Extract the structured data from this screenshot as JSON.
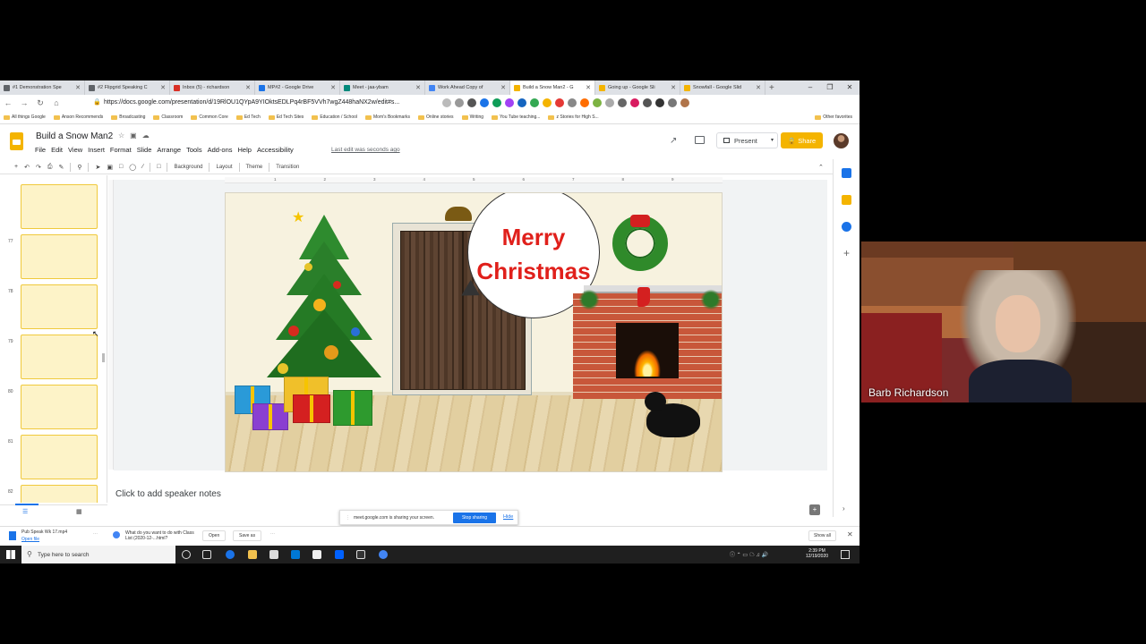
{
  "browser": {
    "tabs": [
      {
        "label": "#1 Demonstration Spe",
        "color": "#5f6368"
      },
      {
        "label": "#2 Flipgrid Speaking C",
        "color": "#5f6368"
      },
      {
        "label": "Inbox (5) - richardson",
        "color": "#d93025"
      },
      {
        "label": "MP#2 - Google Drive",
        "color": "#1a73e8"
      },
      {
        "label": "Meet - jaa-ybam",
        "color": "#00897b"
      },
      {
        "label": "Work Ahead Copy of",
        "color": "#4285f4"
      },
      {
        "label": "Build a Snow Man2 - G",
        "color": "#f4b400"
      },
      {
        "label": "Going up - Google Sli",
        "color": "#f4b400"
      },
      {
        "label": "Snowfall - Google Slid",
        "color": "#f4b400"
      }
    ],
    "active_tab": 6,
    "url": "https://docs.google.com/presentation/d/19RlOU1QYpA9YIOktsEDLPq4rBF5VVh7wgZ448haNX2w/edit#s...",
    "bookmarks": [
      "All things Google",
      "Anson Recommends",
      "Broadcasting",
      "Classroom",
      "Common Core",
      "Ed Tech",
      "Ed Tech Sites",
      "Education / School",
      "Mom's Bookmarks",
      "Online stories",
      "Writing",
      "You Tube teaching...",
      "z Stories for High S..."
    ],
    "other_favorites": "Other favorites"
  },
  "slides": {
    "doc_title": "Build a Snow Man2",
    "menu": [
      "File",
      "Edit",
      "View",
      "Insert",
      "Format",
      "Slide",
      "Arrange",
      "Tools",
      "Add-ons",
      "Help",
      "Accessibility"
    ],
    "last_edit": "Last edit was seconds ago",
    "present_label": "Present",
    "share_label": "Share",
    "toolbar": {
      "background": "Background",
      "layout": "Layout",
      "theme": "Theme",
      "transition": "Transition"
    },
    "thumbs": [
      {
        "num": ""
      },
      {
        "num": "77"
      },
      {
        "num": "78"
      },
      {
        "num": "79"
      },
      {
        "num": "80"
      },
      {
        "num": "81"
      },
      {
        "num": "82"
      }
    ],
    "ruler": [
      "1",
      "2",
      "3",
      "4",
      "5",
      "6",
      "7",
      "8",
      "9"
    ],
    "slide_text_line1": "Merry",
    "slide_text_line2": "Christmas",
    "speaker_notes": "Click to add speaker notes"
  },
  "sharing": {
    "message": "meet.google.com is sharing your screen.",
    "stop": "Stop sharing",
    "hide": "Hide"
  },
  "downloads": {
    "file1": "Pub Speak Wk 17.mp4",
    "file1_action": "Open file",
    "file2": "What do you want to do with Class List (2020-12-...html?",
    "open": "Open",
    "save_as": "Save as",
    "show_all": "Show all"
  },
  "taskbar": {
    "search_placeholder": "Type here to search",
    "time": "2:39 PM",
    "date": "12/19/2020"
  },
  "webcam": {
    "name": "Barb Richardson"
  }
}
